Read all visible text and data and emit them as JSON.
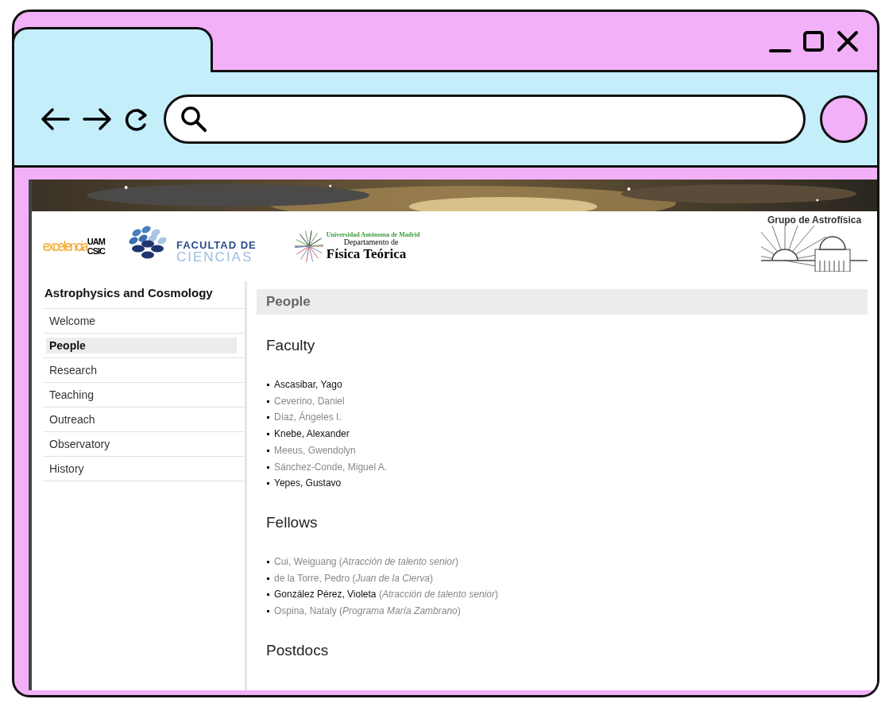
{
  "logos": [
    {
      "kind": "excelencia",
      "texts": [
        "excelencia",
        "UAM",
        "CSIC"
      ]
    },
    {
      "kind": "ciencias",
      "texts": [
        "FACULTAD DE",
        "CIENCIAS"
      ]
    },
    {
      "kind": "fisica",
      "texts": [
        "Universidad Autónoma de Madrid",
        "Departamento de",
        "Física Teórica"
      ]
    },
    {
      "kind": "grupo",
      "texts": [
        "Grupo de Astrofísica"
      ]
    }
  ],
  "sidebar": {
    "title": "Astrophysics and Cosmology",
    "items": [
      {
        "label": "Welcome",
        "selected": false
      },
      {
        "label": "People",
        "selected": true
      },
      {
        "label": "Research",
        "selected": false
      },
      {
        "label": "Teaching",
        "selected": false
      },
      {
        "label": "Outreach",
        "selected": false
      },
      {
        "label": "Observatory",
        "selected": false
      },
      {
        "label": "History",
        "selected": false
      }
    ]
  },
  "main": {
    "title": "People",
    "sections": [
      {
        "heading": "Faculty",
        "people": [
          {
            "name": "Ascasibar, Yago",
            "bold": true
          },
          {
            "name": "Ceverino, Daniel",
            "bold": false
          },
          {
            "name": "Díaz, Ángeles I.",
            "bold": false
          },
          {
            "name": "Knebe, Alexander",
            "bold": true
          },
          {
            "name": "Meeus, Gwendolyn",
            "bold": false
          },
          {
            "name": "Sánchez-Conde, Miguel A.",
            "bold": false
          },
          {
            "name": "Yepes, Gustavo",
            "bold": true
          }
        ]
      },
      {
        "heading": "Fellows",
        "people": [
          {
            "name": "Cui, Weiguang",
            "note": "(*Atracción de talento senior*)",
            "bold": false
          },
          {
            "name": "de la Torre, Pedro",
            "note": "(*Juan de la Cierva*)",
            "bold": false
          },
          {
            "name": "González Pérez, Violeta",
            "note": "(*Atracción de talento senior*)",
            "bold": true
          },
          {
            "name": "Ospina, Nataly",
            "note": "(*Programa María Zambrano*)",
            "bold": false
          }
        ]
      },
      {
        "heading": "Postdocs"
      }
    ]
  }
}
